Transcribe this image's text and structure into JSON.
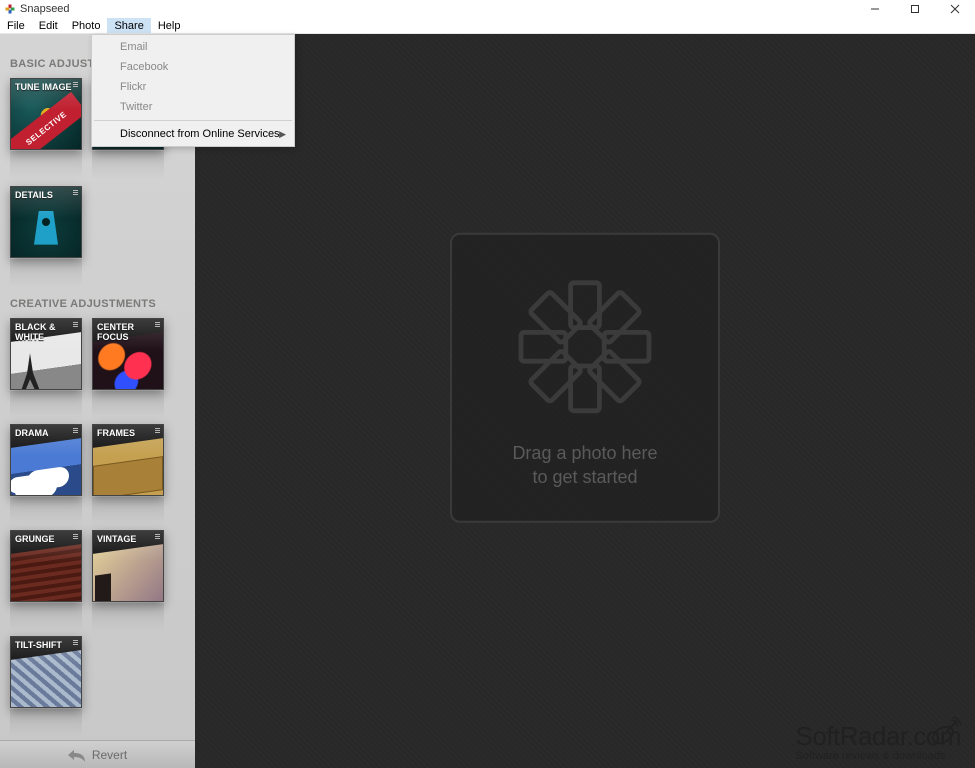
{
  "window": {
    "title": "Snapseed"
  },
  "menubar": {
    "items": [
      "File",
      "Edit",
      "Photo",
      "Share",
      "Help"
    ],
    "active_index": 3
  },
  "dropdown": {
    "items": [
      {
        "label": "Email",
        "enabled": false,
        "submenu": false
      },
      {
        "label": "Facebook",
        "enabled": false,
        "submenu": false
      },
      {
        "label": "Flickr",
        "enabled": false,
        "submenu": false
      },
      {
        "label": "Twitter",
        "enabled": false,
        "submenu": false
      }
    ],
    "footer": {
      "label": "Disconnect from Online Services",
      "enabled": true,
      "submenu": true
    }
  },
  "sidebar": {
    "basic_header": "BASIC ADJUSTMENTS",
    "creative_header": "CREATIVE ADJUSTMENTS",
    "basic": [
      {
        "label": "TUNE IMAGE",
        "badge": "SELECTIVE"
      },
      {
        "label": ""
      },
      {
        "label": "DETAILS"
      }
    ],
    "creative": [
      {
        "label": "BLACK & WHITE"
      },
      {
        "label": "CENTER FOCUS"
      },
      {
        "label": "DRAMA"
      },
      {
        "label": "FRAMES"
      },
      {
        "label": "GRUNGE"
      },
      {
        "label": "VINTAGE"
      },
      {
        "label": "TILT-SHIFT"
      }
    ],
    "revert_label": "Revert"
  },
  "canvas": {
    "drop_line1": "Drag a photo here",
    "drop_line2": "to get started"
  },
  "watermark": {
    "brand": "SoftRadar.com",
    "tagline": "Software reviews & downloads"
  }
}
